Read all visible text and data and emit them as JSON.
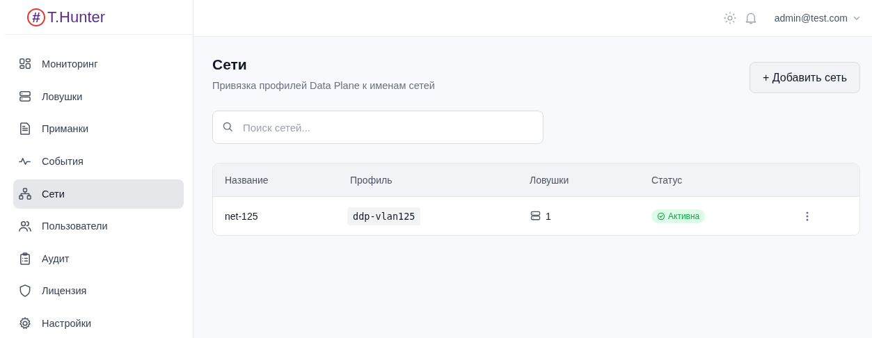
{
  "brand": {
    "mark": "#",
    "name": "T.Hunter"
  },
  "sidebar": {
    "items": [
      {
        "label": "Мониторинг",
        "selected": false
      },
      {
        "label": "Ловушки",
        "selected": false
      },
      {
        "label": "Приманки",
        "selected": false
      },
      {
        "label": "События",
        "selected": false
      },
      {
        "label": "Сети",
        "selected": true
      },
      {
        "label": "Пользователи",
        "selected": false
      },
      {
        "label": "Аудит",
        "selected": false
      },
      {
        "label": "Лицензия",
        "selected": false
      },
      {
        "label": "Настройки",
        "selected": false
      }
    ]
  },
  "topbar": {
    "user": "admin@test.com"
  },
  "page": {
    "title": "Сети",
    "subtitle": "Привязка профилей Data Plane к именам сетей",
    "add_button": "+ Добавить сеть"
  },
  "search": {
    "placeholder": "Поиск сетей..."
  },
  "table": {
    "columns": [
      "Название",
      "Профиль",
      "Ловушки",
      "Статус"
    ],
    "rows": [
      {
        "name": "net-125",
        "profile": "ddp-vlan125",
        "traps": "1",
        "status": "Активна",
        "active": true
      }
    ]
  }
}
